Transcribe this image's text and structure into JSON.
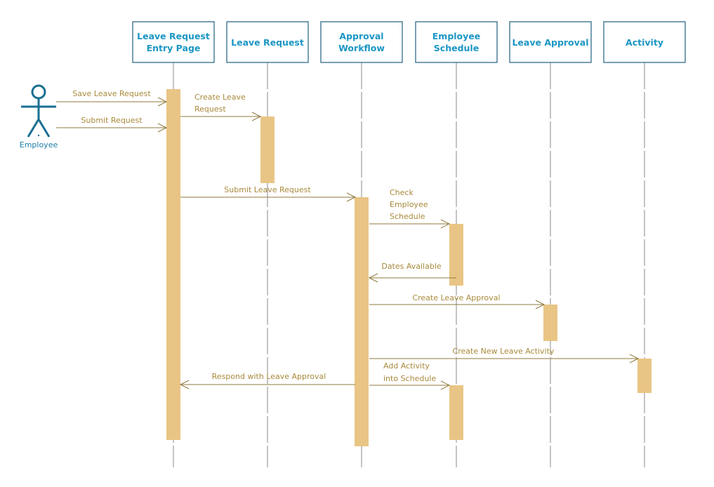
{
  "actor": {
    "label": "Employee",
    "icon": "stick-figure-actor-icon"
  },
  "lifelines": [
    {
      "title": [
        "Leave Request",
        "Entry Page"
      ]
    },
    {
      "title": [
        "Leave Request"
      ]
    },
    {
      "title": [
        "Approval",
        "Workflow"
      ]
    },
    {
      "title": [
        "Employee",
        "Schedule"
      ]
    },
    {
      "title": [
        "Leave Approval"
      ]
    },
    {
      "title": [
        "Activity"
      ]
    }
  ],
  "messages": [
    {
      "label": [
        "Save Leave Request"
      ],
      "from": "Employee",
      "to": "Leave Request Entry Page"
    },
    {
      "label": [
        "Submit  Request"
      ],
      "from": "Employee",
      "to": "Leave Request Entry Page"
    },
    {
      "label": [
        "Create Leave",
        "Request"
      ],
      "from": "Leave Request Entry Page",
      "to": "Leave Request"
    },
    {
      "label": [
        "Submit  Leave Request"
      ],
      "from": "Leave Request Entry Page",
      "to": "Approval Workflow"
    },
    {
      "label": [
        "Check",
        "Employee",
        "Schedule"
      ],
      "from": "Approval Workflow",
      "to": "Employee Schedule"
    },
    {
      "label": [
        "Dates Available"
      ],
      "from": "Employee Schedule",
      "to": "Approval Workflow"
    },
    {
      "label": [
        "Create Leave Approval"
      ],
      "from": "Approval Workflow",
      "to": "Leave Approval"
    },
    {
      "label": [
        "Create New Leave Activity"
      ],
      "from": "Approval Workflow",
      "to": "Activity"
    },
    {
      "label": [
        "Add Activity",
        "into Schedule"
      ],
      "from": "Approval Workflow",
      "to": "Employee Schedule"
    },
    {
      "label": [
        "Respond with Leave Approval"
      ],
      "from": "Approval Workflow",
      "to": "Leave Request Entry Page"
    }
  ],
  "colors": {
    "box_border": "#1f5f7f",
    "header_text": "#1b96c4",
    "actor": "#1a6f93",
    "message_line": "#8f7a3e",
    "message_text": "#a98a3c",
    "activation": "#e9c585",
    "lifeline": "#888888"
  }
}
